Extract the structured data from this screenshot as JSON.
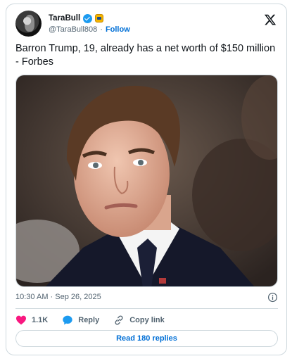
{
  "author": {
    "display_name": "TaraBull",
    "handle": "@TaraBull808",
    "follow_label": "Follow",
    "avatar_icon": "profile-photo-icon",
    "verified_icon": "verified-badge-icon",
    "affiliation_icon": "affiliation-badge-icon"
  },
  "platform_icon": "x-logo-icon",
  "tweet": {
    "text": "Barron Trump, 19, already has a net worth of $150 million - Forbes",
    "timestamp": "10:30 AM · Sep 26, 2025",
    "info_icon": "info-icon"
  },
  "actions": {
    "like": {
      "icon": "heart-icon",
      "label": "1.1K"
    },
    "reply": {
      "icon": "reply-bubble-icon",
      "label": "Reply"
    },
    "copy": {
      "icon": "link-icon",
      "label": "Copy link"
    }
  },
  "read_replies_label": "Read 180 replies",
  "colors": {
    "accent": "#1d9bf0",
    "link": "#006fd6",
    "like": "#f91880",
    "muted": "#536471",
    "border": "#cfd9de"
  }
}
